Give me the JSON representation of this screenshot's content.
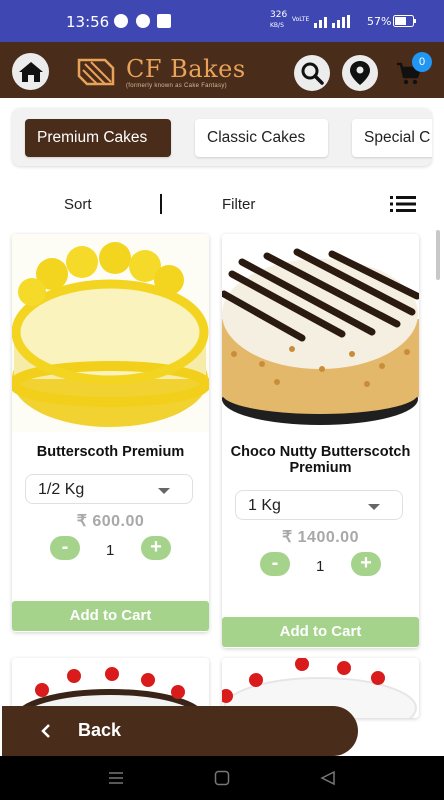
{
  "status_bar": {
    "time": "13:56",
    "net_speed_value": "326",
    "net_speed_unit": "KB/S",
    "signal_label": "VoLTE",
    "battery": "57%"
  },
  "header": {
    "brand_name": "CF Bakes",
    "brand_subtitle": "(formerly known as Cake Fantasy)",
    "cart_count": "0"
  },
  "category_tabs": [
    {
      "label": "Premium Cakes",
      "active": true
    },
    {
      "label": "Classic Cakes",
      "active": false
    },
    {
      "label": "Special C",
      "active": false
    }
  ],
  "toolbar": {
    "sort_label": "Sort",
    "filter_label": "Filter"
  },
  "products": [
    {
      "name": "Butterscoth Premium",
      "size": "1/2 Kg",
      "price": "₹ 600.00",
      "qty": "1",
      "add_label": "Add to Cart"
    },
    {
      "name": "Choco Nutty Butterscotch Premium",
      "size": "1 Kg",
      "price": "₹ 1400.00",
      "qty": "1",
      "add_label": "Add to Cart"
    }
  ],
  "back_bar": {
    "label": "Back"
  },
  "colors": {
    "status_bar": "#3f48b2",
    "header_brown": "#4a2c1a",
    "brand_orange": "#e8a25a",
    "green_button": "#a5d38c",
    "cart_badge": "#2196f3"
  }
}
